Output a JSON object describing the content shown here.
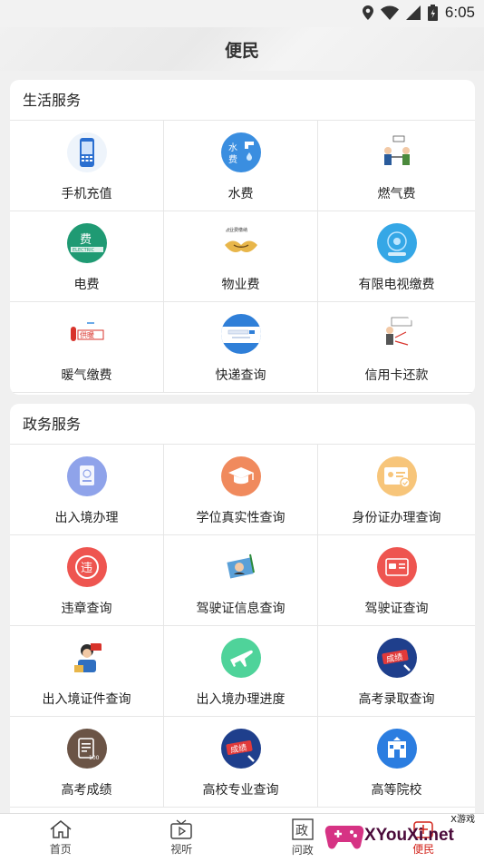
{
  "status": {
    "time": "6:05"
  },
  "header": {
    "title": "便民"
  },
  "life": {
    "title": "生活服务",
    "items": [
      {
        "label": "手机充值",
        "icon": "mobile-recharge-icon"
      },
      {
        "label": "水费",
        "icon": "water-bill-icon"
      },
      {
        "label": "燃气费",
        "icon": "gas-bill-icon"
      },
      {
        "label": "电费",
        "icon": "electricity-bill-icon"
      },
      {
        "label": "物业费",
        "icon": "property-fee-icon"
      },
      {
        "label": "有限电视缴费",
        "icon": "cable-tv-icon"
      },
      {
        "label": "暖气缴费",
        "icon": "heating-icon"
      },
      {
        "label": "快递查询",
        "icon": "express-query-icon"
      },
      {
        "label": "信用卡还款",
        "icon": "credit-card-icon"
      }
    ]
  },
  "gov": {
    "title": "政务服务",
    "items": [
      {
        "label": "出入境办理",
        "icon": "passport-icon"
      },
      {
        "label": "学位真实性查询",
        "icon": "graduation-cap-icon"
      },
      {
        "label": "身份证办理查询",
        "icon": "id-card-icon"
      },
      {
        "label": "违章查询",
        "icon": "violation-icon"
      },
      {
        "label": "驾驶证信息查询",
        "icon": "driver-info-icon"
      },
      {
        "label": "驾驶证查询",
        "icon": "driver-license-icon"
      },
      {
        "label": "出入境证件查询",
        "icon": "entry-exit-doc-icon"
      },
      {
        "label": "出入境办理进度",
        "icon": "plane-icon"
      },
      {
        "label": "高考录取查询",
        "icon": "admission-icon"
      },
      {
        "label": "高考成绩",
        "icon": "exam-score-icon"
      },
      {
        "label": "高校专业查询",
        "icon": "major-query-icon"
      },
      {
        "label": "高等院校",
        "icon": "university-icon"
      }
    ]
  },
  "tabbar": [
    {
      "label": "首页",
      "icon": "home-icon"
    },
    {
      "label": "视听",
      "icon": "video-icon"
    },
    {
      "label": "问政",
      "icon": "politics-icon"
    },
    {
      "label": "便民",
      "icon": "convenience-icon"
    }
  ],
  "watermark": {
    "brand": "XYouXi.net",
    "tag": "X游戏"
  },
  "colors": {
    "accent": "#d2231a",
    "blue": "#3a8ee0",
    "orange": "#f08a5d",
    "red": "#ee5550",
    "green": "#4fd39a",
    "lavender": "#8fa3ea",
    "brown": "#6b5446"
  }
}
